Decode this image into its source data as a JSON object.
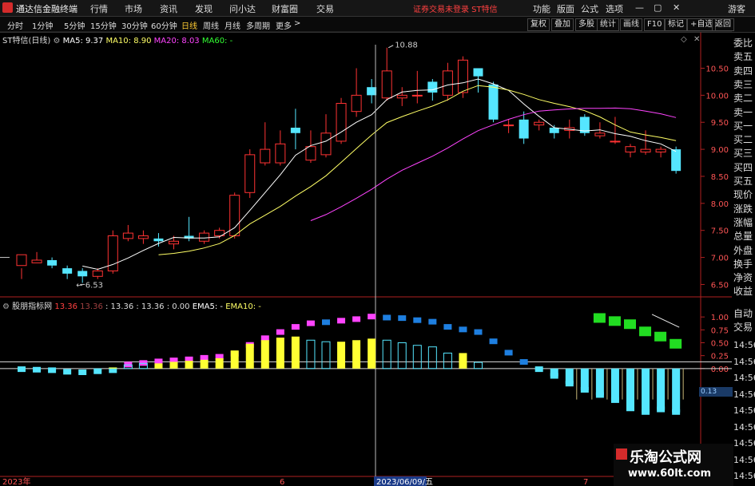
{
  "app": {
    "title": "通达信金融终端",
    "warning": "证券交易未登录 ST特信",
    "guest": "游客"
  },
  "menu": [
    "行情",
    "市场",
    "资讯",
    "发现",
    "问小达",
    "财富圈",
    "交易"
  ],
  "menu_right": [
    "功能",
    "版面",
    "公式",
    "选项"
  ],
  "periods": [
    "分时",
    "1分钟",
    "5分钟",
    "15分钟",
    "30分钟",
    "60分钟",
    "日线",
    "周线",
    "月线",
    "多周期",
    "更多"
  ],
  "active_period": "日线",
  "right_buttons": [
    "复权",
    "叠加",
    "多股",
    "统计",
    "画线",
    "F10",
    "标记",
    "+自选",
    "返回"
  ],
  "main": {
    "stock": "ST特信(日线)",
    "ma5": "MA5: 9.37",
    "ma10": "MA10: 8.90",
    "ma20": "MA20: 8.03",
    "ma60": "MA60: -",
    "ma5_color": "#ffffff",
    "ma10_color": "#ffff66",
    "ma20_color": "#ff44ff",
    "ma60_color": "#33ff33",
    "high_label": "10.88",
    "low_label": "6.53",
    "yticks": [
      "10.50",
      "10.00",
      "9.50",
      "9.00",
      "8.50",
      "8.00",
      "7.50",
      "7.00",
      "6.50"
    ]
  },
  "indicator": {
    "name": "股朋指标网",
    "v1": "13.36",
    "v2": "13.36",
    "v3": ": 13.36 : 13.36 : 0.00",
    "ema5": "EMA5: -",
    "ema10": "EMA10: -",
    "yticks": [
      "1.00",
      "0.75",
      "0.50",
      "0.25",
      "0.00"
    ],
    "badge": "0.13"
  },
  "xaxis": {
    "start": "2023年",
    "m6": "6",
    "m7": "7",
    "cursor_date": "2023/06/09/五"
  },
  "side": {
    "items": [
      "委比",
      "卖五",
      "卖四",
      "卖三",
      "卖二",
      "卖一",
      "买一",
      "买二",
      "买三",
      "买四",
      "买五",
      "现价",
      "涨跌",
      "涨幅",
      "总量",
      "外盘",
      "换手",
      "净资",
      "收益",
      "自动",
      "交易"
    ],
    "times": [
      "14:56",
      "14:56",
      "14:56",
      "14:56",
      "14:56",
      "14:56",
      "14:56",
      "14:56",
      "14:56"
    ]
  },
  "watermark": {
    "line1": "乐淘公式网",
    "line2": "www.60lt.com"
  },
  "colors": {
    "up": "#ff3333",
    "down": "#55e6ff",
    "axis": "#b02020"
  },
  "chart_data": {
    "type": "candlestick",
    "candles": [
      [
        6.85,
        7.05,
        6.8,
        6.6
      ],
      [
        6.9,
        6.95,
        7.1,
        6.9
      ],
      [
        6.95,
        6.85,
        7.0,
        6.8
      ],
      [
        6.8,
        6.7,
        6.85,
        6.6
      ],
      [
        6.75,
        6.65,
        6.8,
        6.53
      ],
      [
        6.65,
        6.75,
        6.8,
        6.6
      ],
      [
        6.75,
        7.4,
        7.5,
        6.7
      ],
      [
        7.35,
        7.45,
        7.6,
        7.3
      ],
      [
        7.35,
        7.4,
        7.5,
        7.25
      ],
      [
        7.35,
        7.3,
        7.45,
        7.2
      ],
      [
        7.25,
        7.3,
        7.4,
        7.15
      ],
      [
        7.4,
        7.35,
        7.75,
        7.3
      ],
      [
        7.3,
        7.45,
        7.5,
        7.25
      ],
      [
        7.4,
        7.5,
        7.55,
        7.35
      ],
      [
        7.4,
        8.15,
        8.2,
        7.35
      ],
      [
        8.2,
        8.9,
        9.0,
        8.1
      ],
      [
        8.75,
        9.0,
        9.5,
        8.7
      ],
      [
        8.75,
        9.1,
        9.35,
        8.7
      ],
      [
        9.4,
        9.3,
        9.75,
        9.0
      ],
      [
        8.8,
        9.05,
        9.35,
        8.75
      ],
      [
        8.9,
        9.3,
        9.65,
        8.85
      ],
      [
        9.15,
        9.85,
        9.95,
        9.1
      ],
      [
        9.7,
        10.0,
        10.5,
        9.6
      ],
      [
        10.15,
        10.0,
        10.3,
        9.85
      ],
      [
        9.95,
        10.45,
        10.88,
        9.9
      ],
      [
        9.95,
        10.0,
        10.15,
        9.8
      ],
      [
        10.0,
        10.0,
        10.45,
        9.85
      ],
      [
        10.25,
        10.05,
        10.3,
        9.9
      ],
      [
        10.0,
        10.45,
        10.6,
        9.9
      ],
      [
        10.05,
        10.65,
        10.72,
        9.95
      ],
      [
        10.5,
        10.35,
        10.5,
        10.05
      ],
      [
        10.2,
        9.55,
        10.25,
        9.5
      ],
      [
        9.45,
        9.45,
        9.55,
        9.3
      ],
      [
        9.55,
        9.2,
        9.7,
        9.1
      ],
      [
        9.45,
        9.5,
        9.55,
        9.35
      ],
      [
        9.4,
        9.3,
        9.45,
        9.2
      ],
      [
        9.35,
        9.4,
        9.55,
        9.2
      ],
      [
        9.6,
        9.3,
        9.65,
        9.25
      ],
      [
        9.25,
        9.3,
        9.5,
        9.2
      ],
      [
        9.15,
        9.15,
        9.6,
        9.1
      ],
      [
        8.95,
        9.05,
        9.1,
        8.85
      ],
      [
        8.95,
        9.0,
        9.35,
        8.9
      ],
      [
        8.95,
        9.0,
        9.05,
        8.85
      ],
      [
        9.0,
        8.6,
        9.05,
        8.55
      ]
    ],
    "ylim": [
      6.3,
      10.95
    ],
    "indicator_bars": [
      [
        -0.02,
        "#55e6ff"
      ],
      [
        -0.03,
        "#55e6ff"
      ],
      [
        -0.04,
        "#55e6ff"
      ],
      [
        -0.07,
        "#55e6ff"
      ],
      [
        -0.08,
        "#55e6ff"
      ],
      [
        -0.06,
        "#55e6ff"
      ],
      [
        -0.04,
        "#55e6ff"
      ],
      [
        0.07,
        "#ff44ff"
      ],
      [
        0.1,
        "#ff44ff"
      ],
      [
        0.13,
        "#ff44ff"
      ],
      [
        0.15,
        "#ff44ff"
      ],
      [
        0.17,
        "#ff44ff"
      ],
      [
        0.2,
        "#ff44ff"
      ],
      [
        0.22,
        "#ff44ff"
      ],
      [
        0.28,
        "#ff44ff"
      ],
      [
        0.45,
        "#ff44ff"
      ],
      [
        0.58,
        "#ff44ff"
      ],
      [
        0.7,
        "#ff44ff"
      ],
      [
        0.8,
        "#ff44ff"
      ],
      [
        0.87,
        "#ff44ff"
      ],
      [
        0.89,
        "#1e7fe0"
      ],
      [
        0.92,
        "#ff44ff"
      ],
      [
        0.95,
        "#ff44ff"
      ],
      [
        1.0,
        "#ff44ff"
      ],
      [
        0.98,
        "#1e7fe0"
      ],
      [
        0.97,
        "#1e7fe0"
      ],
      [
        0.93,
        "#1e7fe0"
      ],
      [
        0.9,
        "#1e7fe0"
      ],
      [
        0.8,
        "#1e7fe0"
      ],
      [
        0.75,
        "#1e7fe0"
      ],
      [
        0.7,
        "#1e7fe0"
      ],
      [
        0.52,
        "#1e7fe0"
      ],
      [
        0.3,
        "#1e7fe0"
      ],
      [
        0.12,
        "#1e7fe0"
      ],
      [
        -0.02,
        "#55e6ff"
      ],
      [
        -0.15,
        "#55e6ff"
      ],
      [
        -0.3,
        "#55e6ff"
      ],
      [
        -0.42,
        "#55e6ff"
      ],
      [
        -0.52,
        "#55e6ff"
      ],
      [
        -0.62,
        "#55e6ff"
      ],
      [
        -0.78,
        "#55e6ff"
      ],
      [
        -0.85,
        "#55e6ff"
      ],
      [
        -0.8,
        "#55e6ff"
      ],
      [
        -0.85,
        "#55e6ff"
      ]
    ],
    "vol_bars": [
      [
        0,
        "#000"
      ],
      [
        0,
        "#000"
      ],
      [
        0,
        "#000"
      ],
      [
        0,
        "#000"
      ],
      [
        0,
        "#000"
      ],
      [
        0,
        "#000"
      ],
      [
        0.02,
        "#ffff33"
      ],
      [
        0.07,
        "#55e6ff"
      ],
      [
        0.1,
        "#55e6ff"
      ],
      [
        0.1,
        "#ffff33"
      ],
      [
        0.13,
        "#ffff33"
      ],
      [
        0.15,
        "#ffff33"
      ],
      [
        0.17,
        "#ffff33"
      ],
      [
        0.2,
        "#ffff33"
      ],
      [
        0.35,
        "#ffff33"
      ],
      [
        0.48,
        "#ffff33"
      ],
      [
        0.55,
        "#ffff33"
      ],
      [
        0.6,
        "#ffff33"
      ],
      [
        0.62,
        "#ffff33"
      ],
      [
        0.55,
        "#55e6ff"
      ],
      [
        0.52,
        "#55e6ff"
      ],
      [
        0.52,
        "#ffff33"
      ],
      [
        0.55,
        "#ffff33"
      ],
      [
        0.58,
        "#ffff33"
      ],
      [
        0.55,
        "#55e6ff"
      ],
      [
        0.5,
        "#55e6ff"
      ],
      [
        0.45,
        "#55e6ff"
      ],
      [
        0.42,
        "#55e6ff"
      ],
      [
        0.3,
        "#55e6ff"
      ],
      [
        0.3,
        "#ffff33"
      ],
      [
        0.12,
        "#55e6ff"
      ]
    ],
    "green_blocks": [
      0.98,
      0.92,
      0.86,
      0.72,
      0.62,
      0.48
    ]
  }
}
